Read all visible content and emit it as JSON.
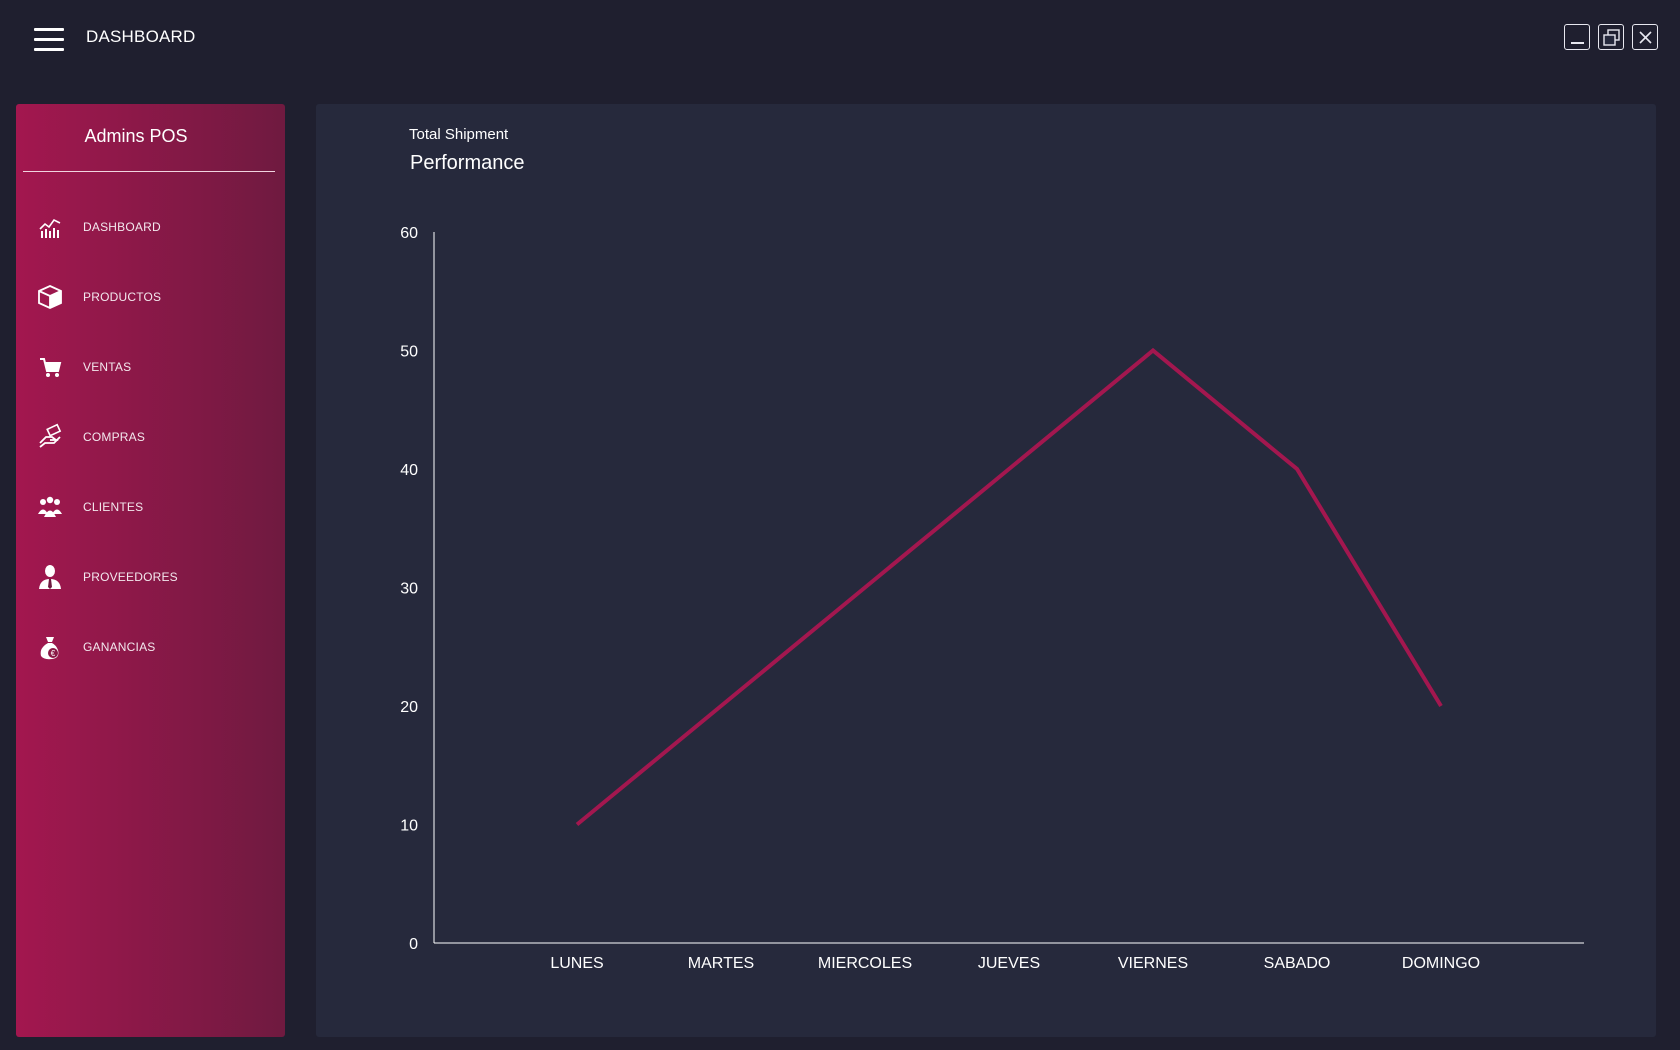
{
  "header": {
    "menu_icon": "hamburger-menu-icon",
    "title": "DASHBOARD",
    "window_controls": [
      "minimize-icon",
      "restore-icon",
      "close-icon"
    ]
  },
  "sidebar": {
    "brand": "Admins POS",
    "items": [
      {
        "label": "DASHBOARD",
        "icon": "chart-icon"
      },
      {
        "label": "PRODUCTOS",
        "icon": "box-icon"
      },
      {
        "label": "VENTAS",
        "icon": "cart-icon"
      },
      {
        "label": "COMPRAS",
        "icon": "hand-payment-icon"
      },
      {
        "label": "CLIENTES",
        "icon": "users-icon"
      },
      {
        "label": "PROVEEDORES",
        "icon": "supplier-icon"
      },
      {
        "label": "GANANCIAS",
        "icon": "money-bag-icon"
      }
    ]
  },
  "main": {
    "subtitle": "Total Shipment",
    "title": "Performance"
  },
  "colors": {
    "background": "#1f1f2f",
    "panel": "#26293c",
    "accent": "#a3174f",
    "line": "#a3174f"
  },
  "chart_data": {
    "type": "line",
    "categories": [
      "LUNES",
      "MARTES",
      "MIERCOLES",
      "JUEVES",
      "VIERNES",
      "SABADO",
      "DOMINGO"
    ],
    "series": [
      {
        "values": [
          10,
          20,
          30,
          40,
          50,
          40,
          20
        ]
      }
    ],
    "yticks": [
      0,
      10,
      20,
      30,
      40,
      50,
      60
    ],
    "ylim": [
      0,
      60
    ],
    "grid": false,
    "legend": "none"
  }
}
